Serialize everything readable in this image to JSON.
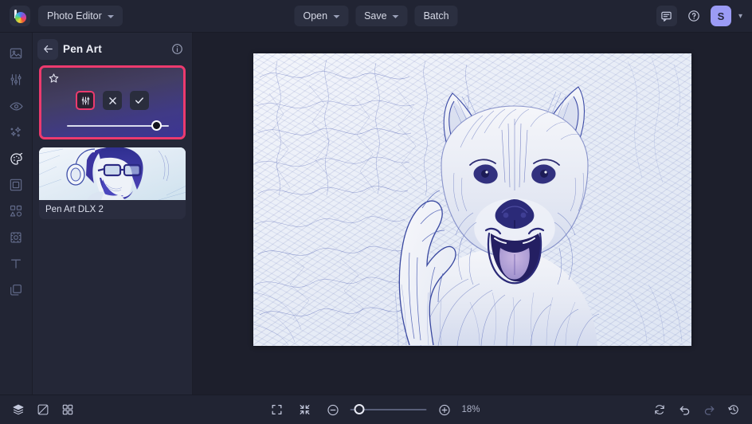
{
  "app": {
    "name": "Photo Editor",
    "accent_pink": "#ec3a6e",
    "accent_avatar": "#9b9bf5",
    "bg_dark": "#1d1f2c",
    "bg_panel": "#242737",
    "bg_topbar": "#21243300"
  },
  "topbar": {
    "logo_icon": "colorful-palette-ball-logo",
    "workspace_label": "Photo Editor",
    "workspace_caret_icon": "chevron-down-icon",
    "open_label": "Open",
    "save_label": "Save",
    "batch_label": "Batch",
    "feedback_icon": "chat-bubble-icon",
    "help_icon": "question-circle-icon",
    "avatar_initial": "S",
    "avatar_caret_icon": "chevron-down-icon"
  },
  "rail": {
    "items": [
      {
        "icon": "image-icon",
        "name": "sidebar-item-image",
        "active": false
      },
      {
        "icon": "sliders-adjust-icon",
        "name": "sidebar-item-adjust",
        "active": false
      },
      {
        "icon": "eye-retouch-icon",
        "name": "sidebar-item-retouch",
        "active": false
      },
      {
        "icon": "sparkles-effects-icon",
        "name": "sidebar-item-effects",
        "active": false
      },
      {
        "icon": "palette-artistic-icon",
        "name": "sidebar-item-artistic",
        "active": true
      },
      {
        "icon": "frame-border-icon",
        "name": "sidebar-item-frames",
        "active": false
      },
      {
        "icon": "shapes-overlay-icon",
        "name": "sidebar-item-overlays",
        "active": false
      },
      {
        "icon": "crop-transform-icon",
        "name": "sidebar-item-transform",
        "active": false
      },
      {
        "icon": "text-icon",
        "name": "sidebar-item-text",
        "active": false
      },
      {
        "icon": "layers-stack-icon",
        "name": "sidebar-item-layers",
        "active": false
      }
    ]
  },
  "panel": {
    "back_icon": "arrow-left-icon",
    "title": "Pen Art",
    "info_icon": "info-circle-icon",
    "selected_preset": {
      "favorite_icon": "star-outline-icon",
      "settings_icon": "sliders-settings-icon",
      "cancel_icon": "close-x-icon",
      "apply_icon": "check-icon",
      "strength_percent": 88
    },
    "presets": [
      {
        "label": "Pen Art DLX 2",
        "thumb": "portrait-man-headphones-pen-art"
      }
    ]
  },
  "canvas": {
    "artwork": "pen-art-sketch-of-smiling-dog-with-hand",
    "artwork_style": "blue-ink-pen-sketch"
  },
  "bottombar": {
    "layers_icon": "layers-icon",
    "compare_icon": "before-after-compare-icon",
    "grid_icon": "grid-view-icon",
    "fit_screen_icon": "fit-to-screen-icon",
    "actual_size_icon": "shrink-to-fit-icon",
    "zoom_out_icon": "zoom-out-minus-icon",
    "zoom_in_icon": "zoom-in-plus-icon",
    "zoom_level": "18%",
    "zoom_slider_percent": 8,
    "reset_icon": "reset-refresh-icon",
    "undo_icon": "undo-arrow-icon",
    "redo_icon": "redo-arrow-icon",
    "history_icon": "history-clock-icon"
  }
}
